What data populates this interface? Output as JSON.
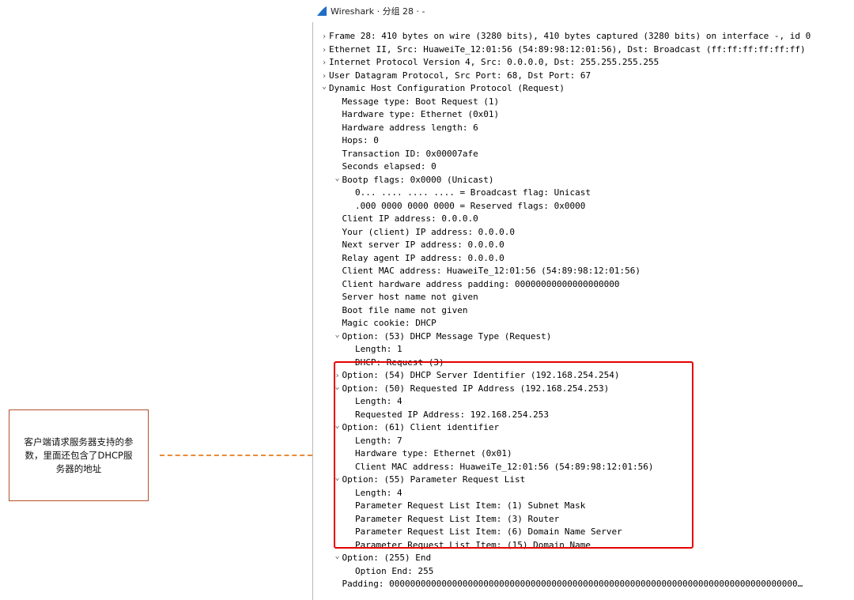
{
  "window": {
    "title": "Wireshark · 分组 28 · -"
  },
  "tree": [
    {
      "indent": 0,
      "twisty": "›",
      "text": "Frame 28: 410 bytes on wire (3280 bits), 410 bytes captured (3280 bits) on interface -, id 0"
    },
    {
      "indent": 0,
      "twisty": "›",
      "text": "Ethernet II, Src: HuaweiTe_12:01:56 (54:89:98:12:01:56), Dst: Broadcast (ff:ff:ff:ff:ff:ff)"
    },
    {
      "indent": 0,
      "twisty": "›",
      "text": "Internet Protocol Version 4, Src: 0.0.0.0, Dst: 255.255.255.255"
    },
    {
      "indent": 0,
      "twisty": "›",
      "text": "User Datagram Protocol, Src Port: 68, Dst Port: 67"
    },
    {
      "indent": 0,
      "twisty": "⌄",
      "text": "Dynamic Host Configuration Protocol (Request)"
    },
    {
      "indent": 1,
      "twisty": "",
      "text": "Message type: Boot Request (1)"
    },
    {
      "indent": 1,
      "twisty": "",
      "text": "Hardware type: Ethernet (0x01)"
    },
    {
      "indent": 1,
      "twisty": "",
      "text": "Hardware address length: 6"
    },
    {
      "indent": 1,
      "twisty": "",
      "text": "Hops: 0"
    },
    {
      "indent": 1,
      "twisty": "",
      "text": "Transaction ID: 0x00007afe"
    },
    {
      "indent": 1,
      "twisty": "",
      "text": "Seconds elapsed: 0"
    },
    {
      "indent": 1,
      "twisty": "⌄",
      "text": "Bootp flags: 0x0000 (Unicast)"
    },
    {
      "indent": 2,
      "twisty": "",
      "text": "0... .... .... .... = Broadcast flag: Unicast"
    },
    {
      "indent": 2,
      "twisty": "",
      "text": ".000 0000 0000 0000 = Reserved flags: 0x0000"
    },
    {
      "indent": 1,
      "twisty": "",
      "text": "Client IP address: 0.0.0.0"
    },
    {
      "indent": 1,
      "twisty": "",
      "text": "Your (client) IP address: 0.0.0.0"
    },
    {
      "indent": 1,
      "twisty": "",
      "text": "Next server IP address: 0.0.0.0"
    },
    {
      "indent": 1,
      "twisty": "",
      "text": "Relay agent IP address: 0.0.0.0"
    },
    {
      "indent": 1,
      "twisty": "",
      "text": "Client MAC address: HuaweiTe_12:01:56 (54:89:98:12:01:56)"
    },
    {
      "indent": 1,
      "twisty": "",
      "text": "Client hardware address padding: 00000000000000000000"
    },
    {
      "indent": 1,
      "twisty": "",
      "text": "Server host name not given"
    },
    {
      "indent": 1,
      "twisty": "",
      "text": "Boot file name not given"
    },
    {
      "indent": 1,
      "twisty": "",
      "text": "Magic cookie: DHCP"
    },
    {
      "indent": 1,
      "twisty": "⌄",
      "text": "Option: (53) DHCP Message Type (Request)"
    },
    {
      "indent": 2,
      "twisty": "",
      "text": "Length: 1"
    },
    {
      "indent": 2,
      "twisty": "",
      "text": "DHCP: Request (3)"
    },
    {
      "indent": 1,
      "twisty": "›",
      "text": "Option: (54) DHCP Server Identifier (192.168.254.254)"
    },
    {
      "indent": 1,
      "twisty": "⌄",
      "text": "Option: (50) Requested IP Address (192.168.254.253)"
    },
    {
      "indent": 2,
      "twisty": "",
      "text": "Length: 4"
    },
    {
      "indent": 2,
      "twisty": "",
      "text": "Requested IP Address: 192.168.254.253"
    },
    {
      "indent": 1,
      "twisty": "⌄",
      "text": "Option: (61) Client identifier"
    },
    {
      "indent": 2,
      "twisty": "",
      "text": "Length: 7"
    },
    {
      "indent": 2,
      "twisty": "",
      "text": "Hardware type: Ethernet (0x01)"
    },
    {
      "indent": 2,
      "twisty": "",
      "text": "Client MAC address: HuaweiTe_12:01:56 (54:89:98:12:01:56)"
    },
    {
      "indent": 1,
      "twisty": "⌄",
      "text": "Option: (55) Parameter Request List"
    },
    {
      "indent": 2,
      "twisty": "",
      "text": "Length: 4"
    },
    {
      "indent": 2,
      "twisty": "",
      "text": "Parameter Request List Item: (1) Subnet Mask"
    },
    {
      "indent": 2,
      "twisty": "",
      "text": "Parameter Request List Item: (3) Router"
    },
    {
      "indent": 2,
      "twisty": "",
      "text": "Parameter Request List Item: (6) Domain Name Server"
    },
    {
      "indent": 2,
      "twisty": "",
      "text": "Parameter Request List Item: (15) Domain Name"
    },
    {
      "indent": 1,
      "twisty": "⌄",
      "text": "Option: (255) End"
    },
    {
      "indent": 2,
      "twisty": "",
      "text": "Option End: 255"
    },
    {
      "indent": 1,
      "twisty": "",
      "text": "Padding: 000000000000000000000000000000000000000000000000000000000000000000000000000000…"
    }
  ],
  "annotation": {
    "text": "客户端请求服务器支持的参数，里面还包含了DHCP服务器的地址",
    "box_border_color": "#b0502c",
    "line_color": "#e88c3a",
    "highlight_color": "#e60000"
  },
  "icons": {
    "title_icon": "wireshark-fin-icon",
    "expanded": "chevron-down-icon",
    "collapsed": "chevron-right-icon"
  }
}
